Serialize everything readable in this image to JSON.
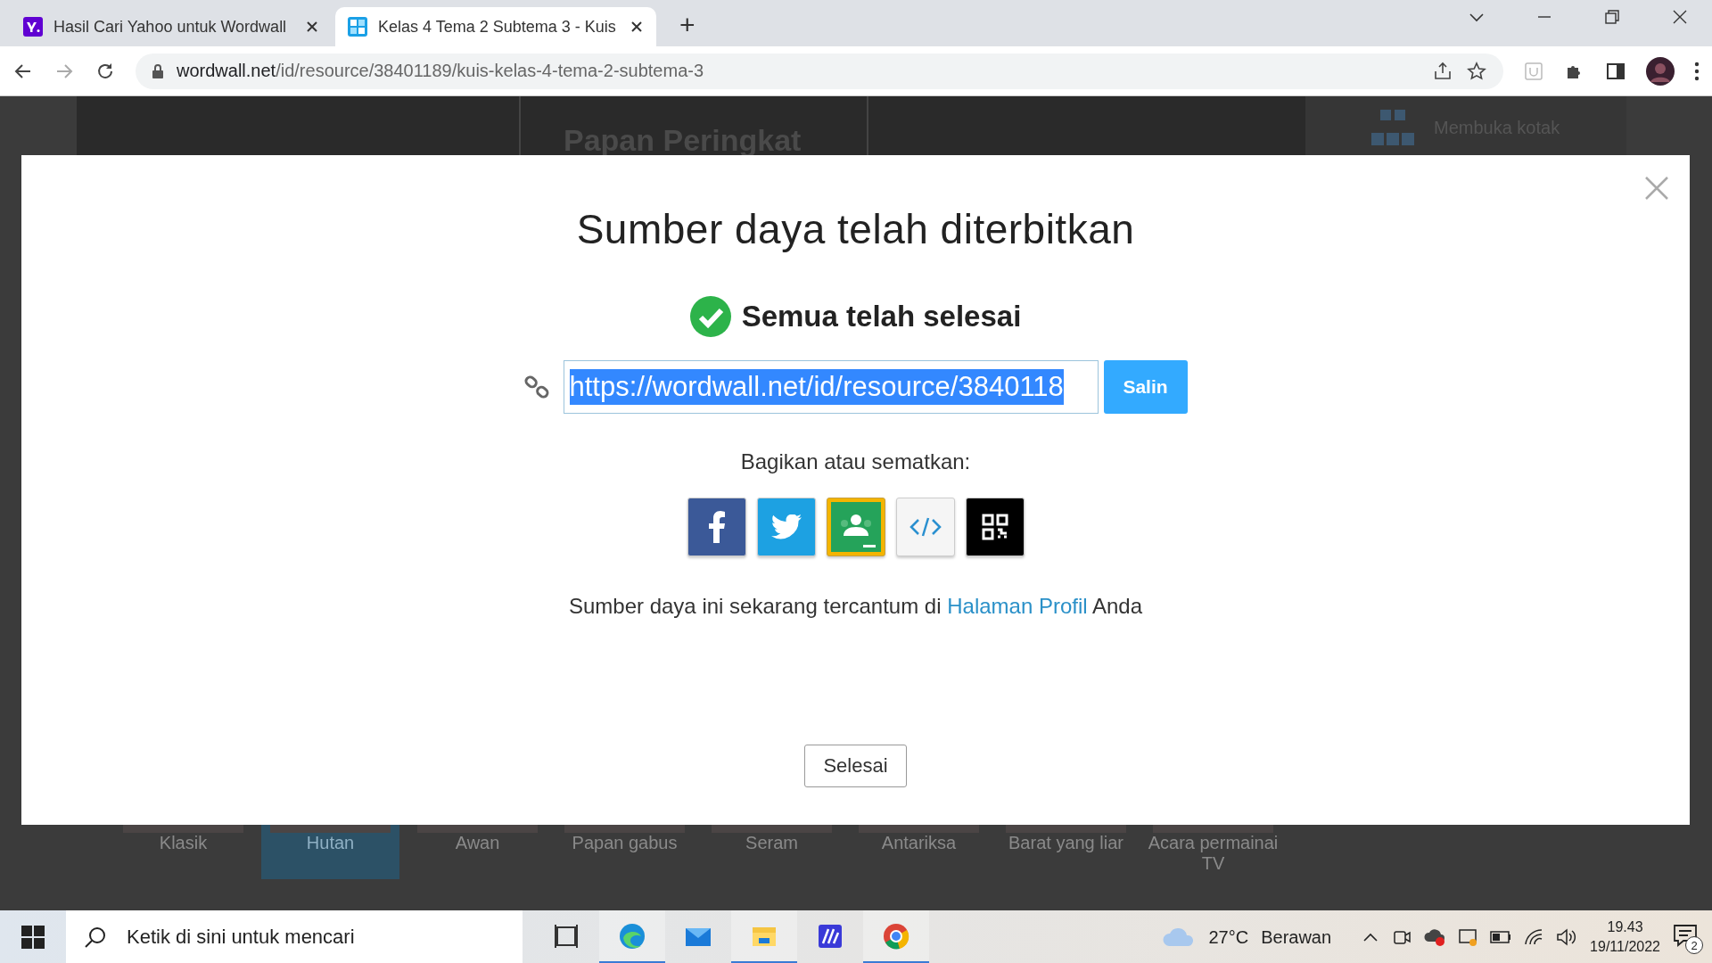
{
  "browser": {
    "tabs": [
      {
        "title": "Hasil Cari Yahoo untuk Wordwall",
        "kind": "yahoo",
        "selected": false
      },
      {
        "title": "Kelas 4 Tema 2 Subtema 3 - Kuis",
        "kind": "wordwall",
        "selected": true
      }
    ],
    "new_tab": "+",
    "address": {
      "domain": "wordwall.net",
      "path": "/id/resource/38401189/kuis-kelas-4-tema-2-subtema-3"
    }
  },
  "background": {
    "heading": "Papan Peringkat",
    "side_item": "Membuka kotak",
    "themes": [
      {
        "label": "Klasik",
        "selected": false
      },
      {
        "label": "Hutan",
        "selected": true
      },
      {
        "label": "Awan",
        "selected": false
      },
      {
        "label": "Papan gabus",
        "selected": false
      },
      {
        "label": "Seram",
        "selected": false
      },
      {
        "label": "Antariksa",
        "selected": false
      },
      {
        "label": "Barat yang liar",
        "selected": false
      },
      {
        "label": "Acara permainai",
        "label_2": "TV",
        "selected": false
      }
    ]
  },
  "modal": {
    "title": "Sumber daya telah diterbitkan",
    "status": "Semua telah selesai",
    "link": {
      "value": "https://wordwall.net/id/resource/3840118",
      "button": "Salin"
    },
    "share_label": "Bagikan atau sematkan:",
    "share_buttons": [
      {
        "kind": "facebook"
      },
      {
        "kind": "twitter"
      },
      {
        "kind": "classroom"
      },
      {
        "kind": "embed"
      },
      {
        "kind": "qr"
      }
    ],
    "note_before": "Sumber daya ini sekarang tercantum di",
    "note_link": "Halaman Profil",
    "note_after": "Anda",
    "done_button": "Selesai"
  },
  "taskbar": {
    "search_placeholder": "Ketik di sini untuk mencari",
    "apps": [
      {
        "kind": "taskview",
        "selected": false
      },
      {
        "kind": "edge",
        "selected": true
      },
      {
        "kind": "mail",
        "selected": false
      },
      {
        "kind": "explorer",
        "selected": true
      },
      {
        "kind": "app",
        "selected": false
      },
      {
        "kind": "chrome",
        "selected": true
      }
    ],
    "weather": {
      "temp": "27°C",
      "condition": "Berawan"
    },
    "time": "19.43",
    "date": "19/11/2022",
    "notifications": "2"
  }
}
